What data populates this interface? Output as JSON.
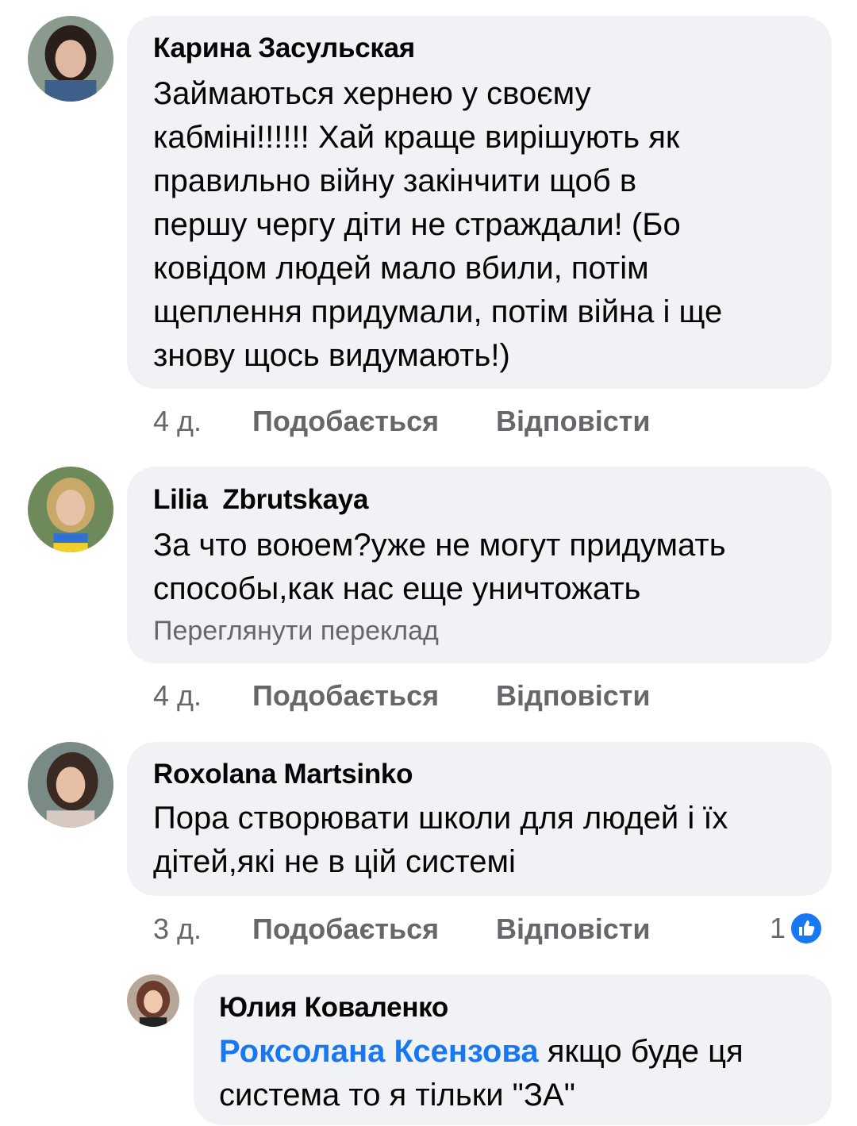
{
  "comments": [
    {
      "author": "Карина Засульская",
      "lines": [
        "Займаються хернею у своєму",
        "кабміні!!!!!! Хай краще вирішують як",
        "правильно війну закінчити щоб в",
        "першу чергу діти не страждали! (Бо",
        "ковідом людей мало вбили, потім",
        "щеплення придумали, потім війна і ще",
        "знову щось видумають!)"
      ],
      "time": "4 д.",
      "like_label": "Подобається",
      "reply_label": "Відповісти"
    },
    {
      "author": "Lilia  Zbrutskaya",
      "lines": [
        "За что воюем?уже не могут придумать",
        "способы,как нас еще уничтожать"
      ],
      "translate": "Переглянути переклад",
      "time": "4 д.",
      "like_label": "Подобається",
      "reply_label": "Відповісти"
    },
    {
      "author": "Roxolana Martsinko",
      "lines": [
        "Пора створювати школи для людей і їх",
        "дітей,які не в цій системі"
      ],
      "time": "3 д.",
      "like_label": "Подобається",
      "reply_label": "Відповісти",
      "reaction_count": "1",
      "reaction_icon": "like-icon"
    }
  ],
  "reply": {
    "author": "Юлия Коваленко",
    "mention": "Роксолана Ксензова",
    "line1_rest": " якщо буде ця",
    "line2": "система то я тільки \"ЗА\""
  },
  "colors": {
    "bubble": "#f0f2f5",
    "meta_text": "#65676b",
    "mention": "#1877f2",
    "like_badge": "#1877f2"
  }
}
